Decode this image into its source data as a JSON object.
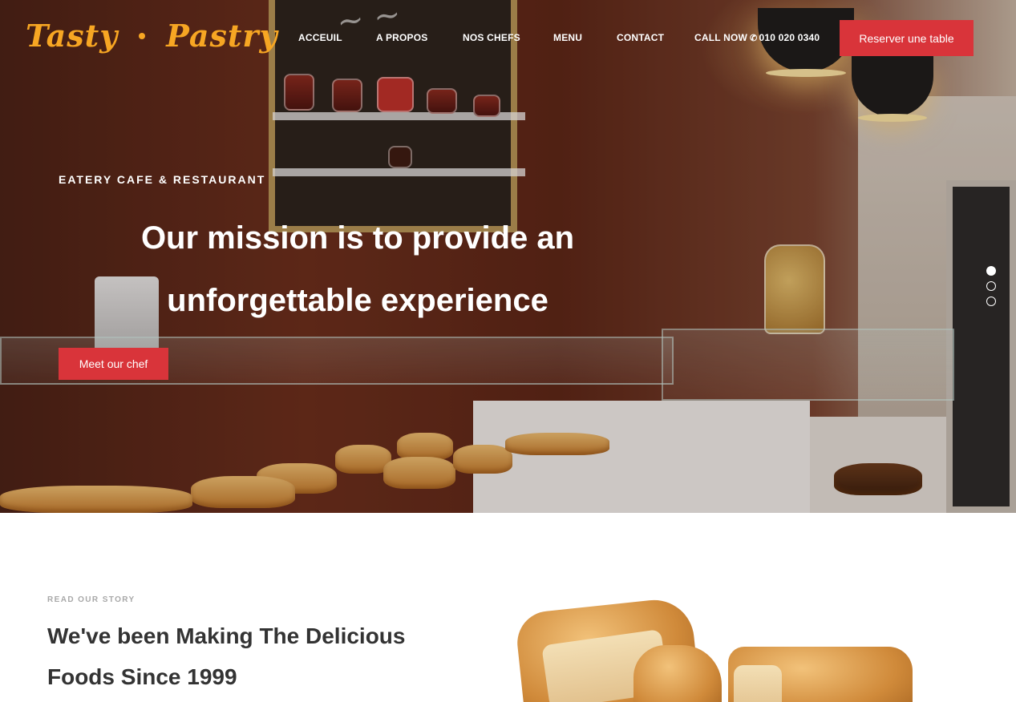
{
  "brand": {
    "name_left": "Tasty",
    "name_right": "Pastry",
    "color": "#f7a623"
  },
  "nav": {
    "items": [
      "ACCEUIL",
      "A PROPOS",
      "NOS CHEFS",
      "MENU",
      "CONTACT"
    ],
    "call_label": "CALL NOW",
    "phone_icon": "phone-icon",
    "phone_number": "010 020 0340",
    "reserve_label": "Reserver une table"
  },
  "hero": {
    "eyebrow": "EATERY CAFE & RESTAURANT",
    "headline": "Our mission is to provide an unforgettable experience",
    "cta_label": "Meet our chef",
    "slides_total": 3,
    "active_slide": 1
  },
  "story": {
    "eyebrow": "READ OUR STORY",
    "title": "We've been Making The Delicious Foods Since 1999"
  },
  "colors": {
    "accent": "#d9343a",
    "text_dark": "#333333",
    "muted": "#a8a8a8"
  }
}
